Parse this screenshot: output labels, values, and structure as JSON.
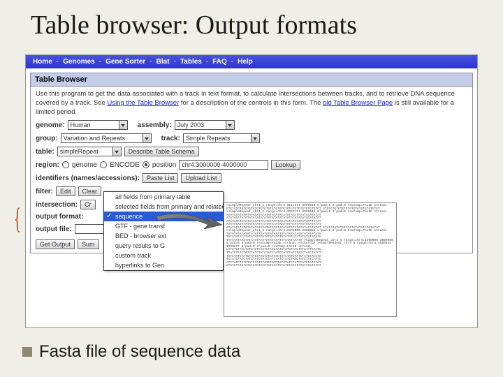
{
  "slide": {
    "title": "Table browser: Output formats"
  },
  "nav": {
    "items": [
      "Home",
      "Genomes",
      "Gene Sorter",
      "Blat",
      "Tables",
      "FAQ",
      "Help"
    ]
  },
  "panel_title": "Table Browser",
  "intro": {
    "t1": "Use this program to get the data associated with a track in text format, to calculate intersections between tracks, and to retrieve DNA sequence covered by a track. See ",
    "link1": "Using the Table Browser",
    "t2": " for a description of the controls in this form. The ",
    "link2": "old Table Browser Page",
    "t3": " is still available for a limited period."
  },
  "labels": {
    "genome": "genome:",
    "assembly": "assembly:",
    "group": "group:",
    "track": "track:",
    "table": "table:",
    "describe": "Describe Table Schema",
    "region": "region:",
    "r_genome": "genome",
    "r_encode": "ENCODE",
    "r_position": "position",
    "lookup": "Lookup",
    "identifiers": "identifiers (names/accessions):",
    "paste": "Paste List",
    "upload": "Upload List",
    "filter": "filter:",
    "edit": "Edit",
    "clear": "Clear",
    "intersection": "intersection:",
    "create": "Cr",
    "outfmt": "output format:",
    "outfile": "output file:",
    "get": "Get Output",
    "summary": "Sum"
  },
  "values": {
    "genome": "Human",
    "assembly": "July 2003",
    "group": "Variation and Repeats",
    "track": "Simple Repeats",
    "table": "simpleRepeat",
    "position": "chr4:3000000-4000000",
    "outfile": ""
  },
  "dropdown": {
    "options": [
      "all fields from primary table",
      "selected fields from primary and related tables",
      "sequence",
      "GTF - gene transf",
      "BED - browser ext",
      "query results to G",
      "custom track",
      "hyperlinks to Gen"
    ],
    "selected_index": 2
  },
  "fasta_preview": ">simpleRepeat_chr4_1 range=chr4:3111273-3999933 5'pad=0 3'pad=0 revComp=FALSE strand=\nGTGTGTGTGTGTGTGTGTGTGTGTGTGTGTGTGTGTGTGTGTGTGTGTGT\nGTGTGTGTGTGTGTGTGTGTGTGTGTGTGT\n>simpleRepeat_chr4_2 range=chr4:3222111-3999944 5'pad=0 3'pad=0 revComp=FALSE strand=\nATATATATATATATATATATATATATATATATATATATATATATATATAT\nATATATATATATATATATATATATATATATATATATATATATATATATAT\nATATATATATATATATATATATATATATATATATATATATATATATATAT\nATATATATATATATATATATATATATATATATATATATATATATATATAT\nATATATATATATATATATATATATATATATATATATATATATATATATAT\nATATATATATATATATATATATATATATAT\n>simpleRepeat_chr4_3 range=chr4:3331000-3999955 5'pad=0 3'pad=0 revComp=FALSE strand=\nTATATATATATATATATATATATATATATATATATATATATATATATATA\nTATATATATATATATATATATATATATATATATATATATATATATATATA\nTATATATATATATATATATATATATATATATATATATATA\n>simpleRepeat_chr4_4 range=chr4:3400000-3999966 5'pad=0 3'pad=0 revComp=FALSE strand=\nATCGATCGA\n>simpleRepeat_chr4_5 range=chr4:3500333-3999977 5'pad=0 3'pad=0 revComp=FALSE strand=\nCTTATCTATCTATCTATCTATCTATCTATCTATCTATCTATCTATCTATC\nTTATCTATCTATCTATCTATCTATCTATCTATCTATCTATCTATCTATCT\nTATCTATCTATCTATCTATCTATCTATCTATCTATCTATCTATCTATCTA\nTCTATCTATCTATCTATCTATCTATCTATCTATCTATCTATCTATCTATC\nATCTATCTATCTATCTATCTATCTATCTATCTATCTATCTATCTATCTAT\nCTATCTATCTATCTATCTATCTATCTATCTATCTATCTATCTATCTATCT",
  "bullet": "Fasta file of sequence data"
}
